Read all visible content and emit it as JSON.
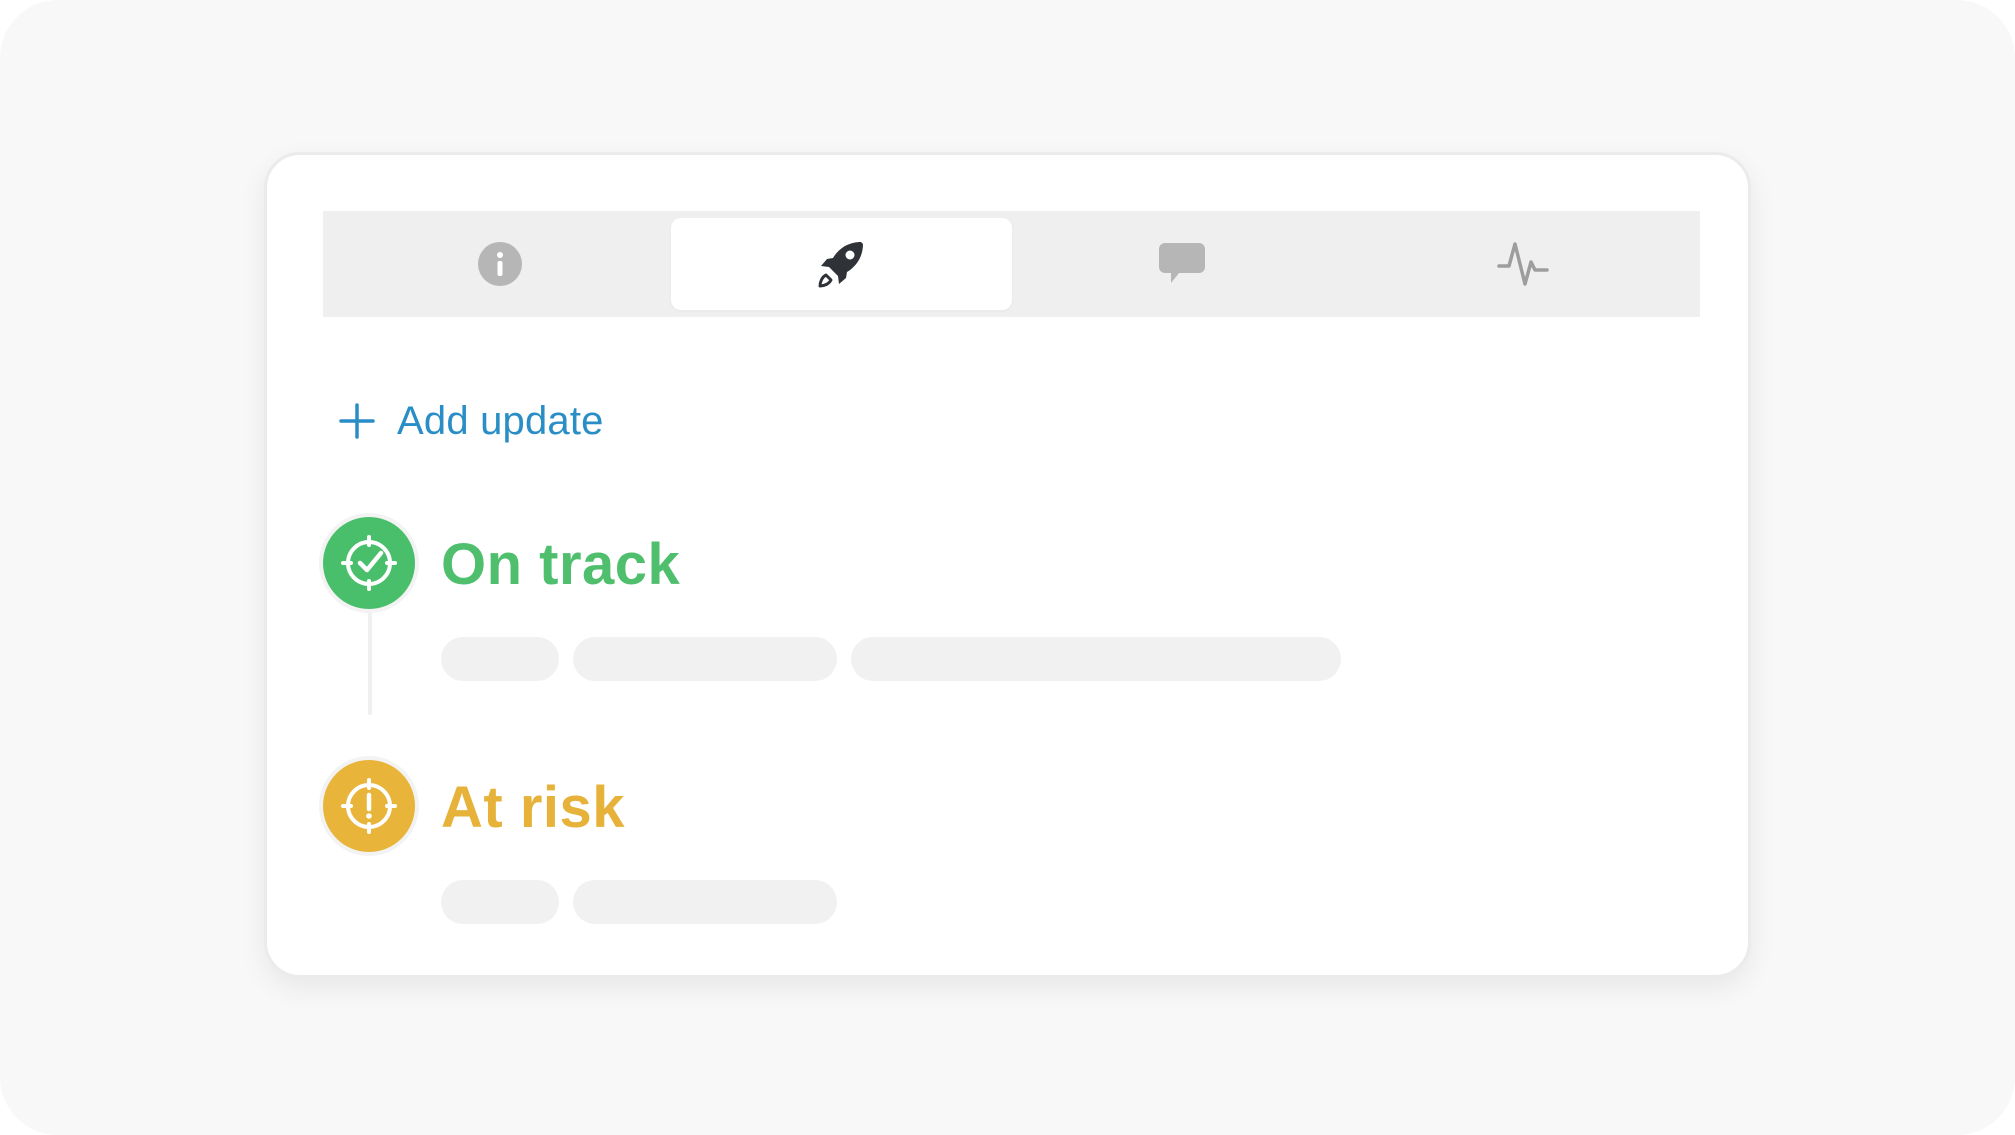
{
  "tabs": [
    {
      "name": "info",
      "icon": "info-icon",
      "active": false
    },
    {
      "name": "updates",
      "icon": "rocket-icon",
      "active": true
    },
    {
      "name": "comments",
      "icon": "comment-icon",
      "active": false
    },
    {
      "name": "activity",
      "icon": "activity-icon",
      "active": false
    }
  ],
  "add_update": {
    "label": "Add update",
    "icon": "plus-icon"
  },
  "updates": [
    {
      "status": "On track",
      "icon": "target-check-icon",
      "color": "#49bf6b"
    },
    {
      "status": "At risk",
      "icon": "exclamation-circle-icon",
      "color": "#e8b43a"
    }
  ],
  "colors": {
    "accent": "#2a8ec6",
    "on_track": "#49bf6b",
    "at_risk": "#e8b43a",
    "tabbar": "#efefef",
    "placeholder": "#f1f1f1"
  }
}
